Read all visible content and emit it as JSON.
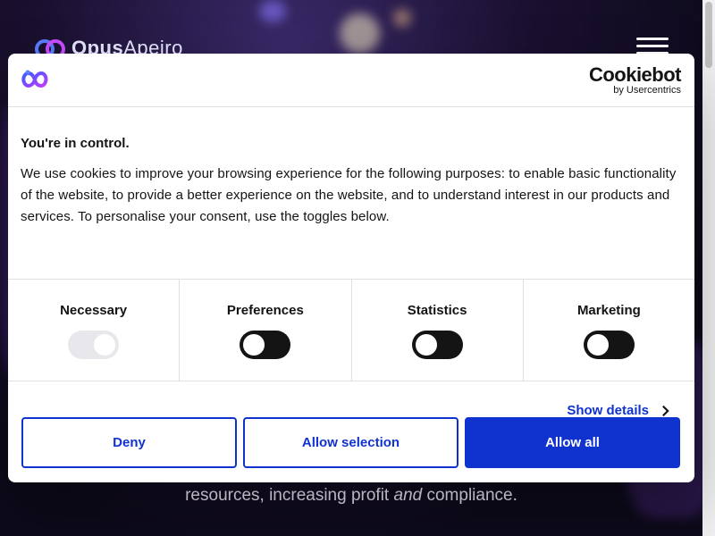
{
  "site": {
    "logo_name": "Opus",
    "logo_name_light": "Apeiro",
    "hero_prefix": "resources, increasing profit ",
    "hero_em": "and",
    "hero_suffix": " compliance."
  },
  "dialog": {
    "brand_main": "Cookiebot",
    "brand_sub": "by Usercentrics",
    "title": "You're in control.",
    "text": "We use cookies to improve your browsing experience for the following purposes: to enable basic functionality of the website, to provide a better experience on the website, and to understand interest in our products and services. To personalise your consent, use the toggles below.",
    "toggles": [
      {
        "label": "Necessary",
        "state": "on",
        "disabled": true
      },
      {
        "label": "Preferences",
        "state": "off",
        "disabled": false
      },
      {
        "label": "Statistics",
        "state": "off",
        "disabled": false
      },
      {
        "label": "Marketing",
        "state": "off",
        "disabled": false
      }
    ],
    "show_details": "Show details",
    "buttons": {
      "deny": "Deny",
      "allow_selection": "Allow selection",
      "allow_all": "Allow all"
    }
  },
  "colors": {
    "accent": "#1032cf",
    "toggle_off": "#141414",
    "toggle_disabled": "#e8e8ec"
  },
  "icons": [
    "opus-apeiro-logo",
    "hamburger-menu-icon",
    "cookiebot-site-logo",
    "chevron-right-icon"
  ]
}
